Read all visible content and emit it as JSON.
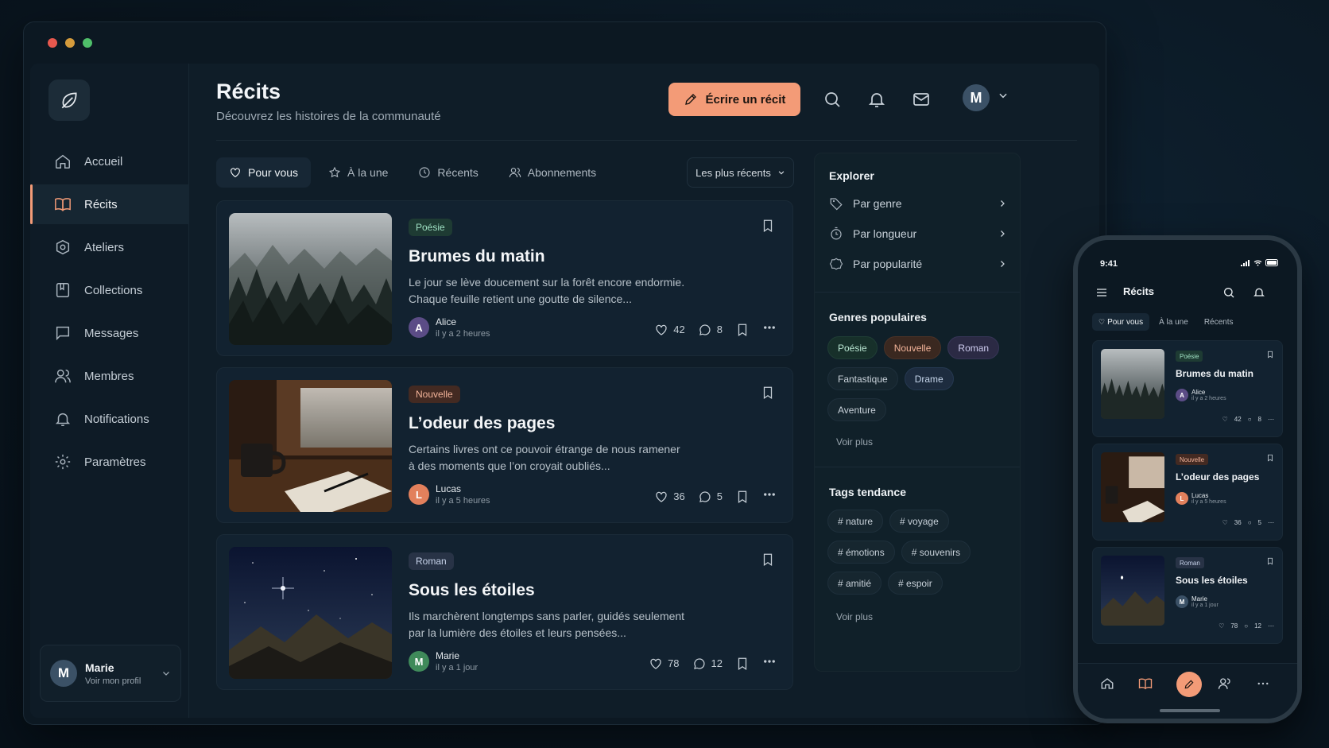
{
  "app": {
    "window_title": ""
  },
  "sidebar": {
    "items": [
      {
        "label": "Accueil",
        "icon": "home-icon"
      },
      {
        "label": "Récits",
        "icon": "book-icon",
        "active": true
      },
      {
        "label": "Ateliers",
        "icon": "workshop-icon"
      },
      {
        "label": "Collections",
        "icon": "collection-icon"
      },
      {
        "label": "Messages",
        "icon": "message-icon"
      },
      {
        "label": "Membres",
        "icon": "users-icon"
      },
      {
        "label": "Notifications",
        "icon": "bell-icon"
      },
      {
        "label": "Paramètres",
        "icon": "gear-icon"
      }
    ],
    "profile": {
      "initial": "M",
      "name": "Marie",
      "sub": "Voir mon profil"
    }
  },
  "header": {
    "title": "Récits",
    "subtitle": "Découvrez les histoires de la communauté",
    "write_label": "Écrire un récit",
    "avatar_initial": "M"
  },
  "tabs": [
    {
      "label": "Pour vous",
      "icon": "heart-icon",
      "active": true
    },
    {
      "label": "À la une",
      "icon": "star-icon"
    },
    {
      "label": "Récents",
      "icon": "clock-icon"
    },
    {
      "label": "Abonnements",
      "icon": "users-icon"
    }
  ],
  "sort": {
    "label": "Les plus récents"
  },
  "stories": [
    {
      "genre": "Poésie",
      "title": "Brumes du matin",
      "excerpt_1": "Le jour se lève doucement sur la forêt encore endormie.",
      "excerpt_2": "Chaque feuille retient une goutte de silence...",
      "author": "Alice",
      "initial": "A",
      "time": "il y a 2 heures",
      "likes": "42",
      "comments": "8"
    },
    {
      "genre": "Nouvelle",
      "title": "L’odeur des pages",
      "excerpt_1": "Certains livres ont ce pouvoir étrange de nous ramener",
      "excerpt_2": "à des moments que l’on croyait oubliés...",
      "author": "Lucas",
      "initial": "L",
      "time": "il y a 5 heures",
      "likes": "36",
      "comments": "5"
    },
    {
      "genre": "Roman",
      "title": "Sous les étoiles",
      "excerpt_1": "Ils marchèrent longtemps sans parler, guidés seulement",
      "excerpt_2": "par la lumière des étoiles et leurs pensées...",
      "author": "Marie",
      "initial": "M",
      "time": "il y a 1 jour",
      "likes": "78",
      "comments": "12"
    }
  ],
  "explore": {
    "title": "Explorer",
    "items": [
      "Par genre",
      "Par longueur",
      "Par popularité"
    ]
  },
  "genres": {
    "title": "Genres populaires",
    "chips": [
      "Poésie",
      "Nouvelle",
      "Roman",
      "Fantastique",
      "Drame",
      "Aventure"
    ],
    "more": "Voir plus"
  },
  "tags": {
    "title": "Tags tendance",
    "chips": [
      "# nature",
      "# voyage",
      "# émotions",
      "# souvenirs",
      "# amitié",
      "# espoir"
    ],
    "more": "Voir plus"
  },
  "phone": {
    "time": "9:41",
    "title": "Récits",
    "tabs": [
      "Pour vous",
      "À la une",
      "Récents"
    ]
  },
  "colors": {
    "accent": "#f39b77",
    "bg": "#0c1822",
    "card": "#122230"
  }
}
